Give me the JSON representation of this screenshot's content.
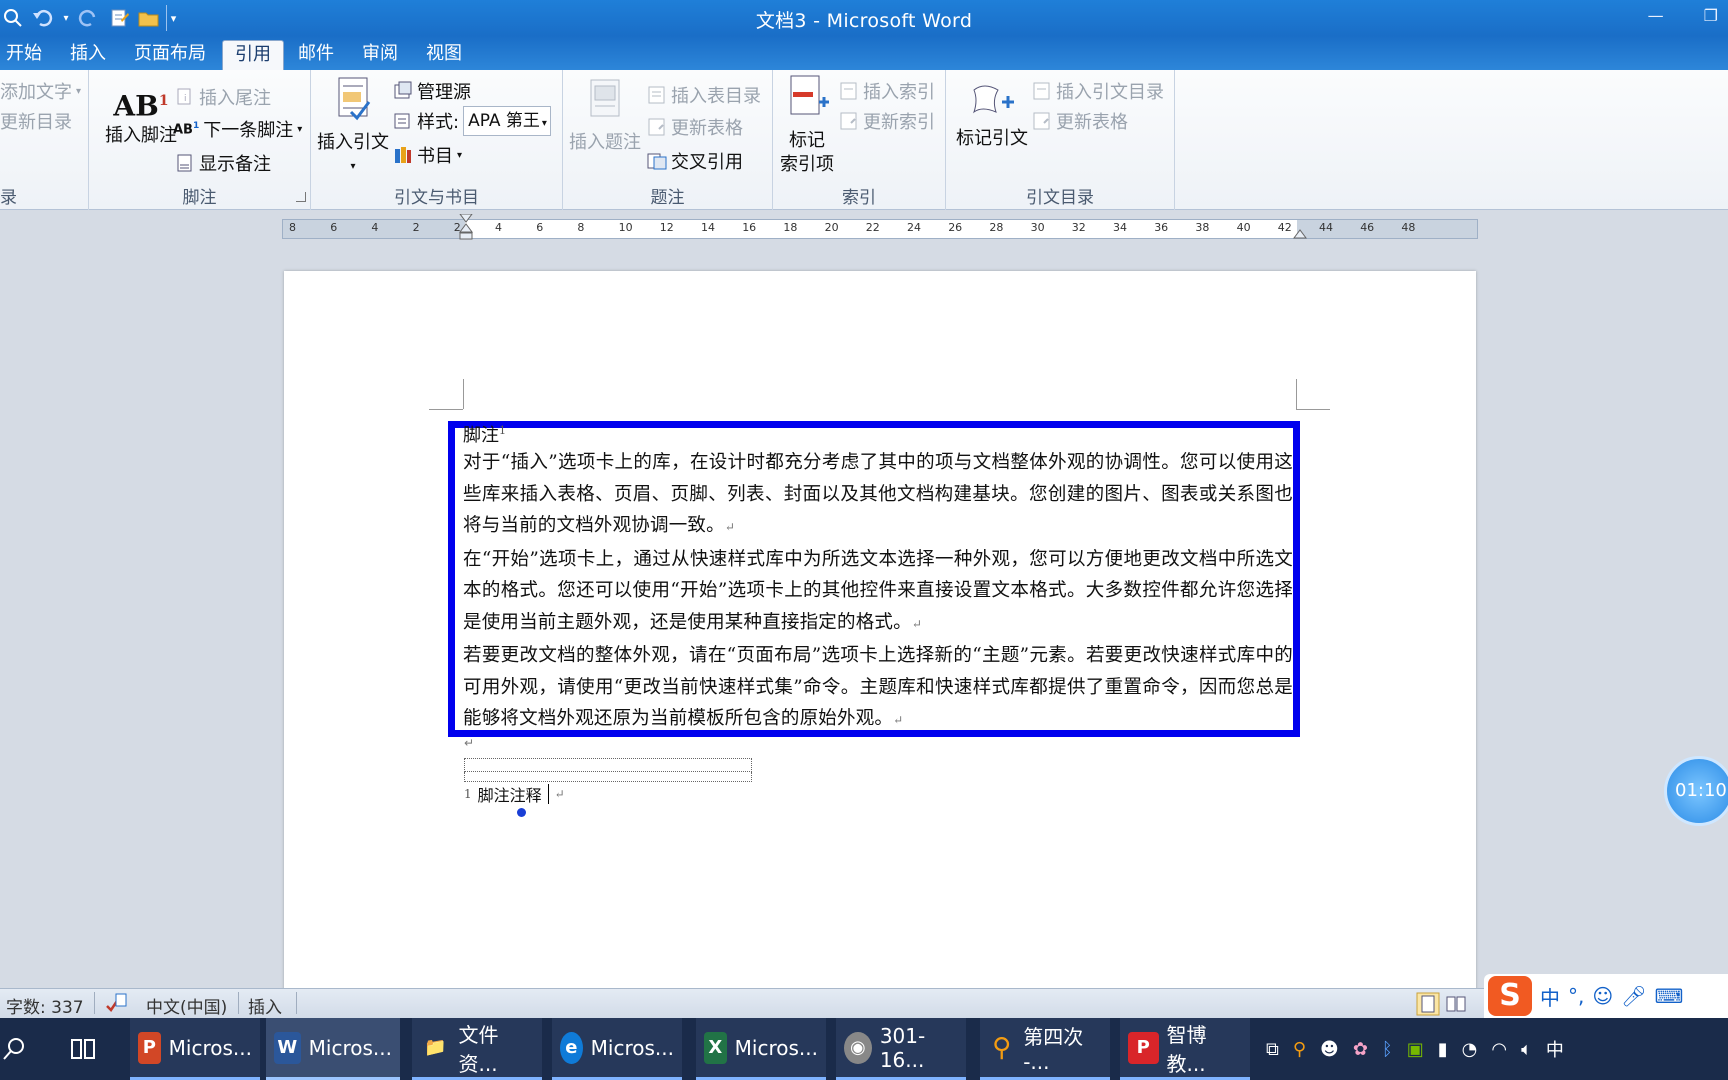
{
  "window": {
    "title": "文档3 - Microsoft Word",
    "minimize_glyph": "—",
    "restore_glyph": "❐"
  },
  "tabs": [
    "开始",
    "插入",
    "页面布局",
    "引用",
    "邮件",
    "审阅",
    "视图"
  ],
  "active_tab": "引用",
  "ribbon": {
    "toc_group": {
      "add_text": "添加文字",
      "update_toc": "更新目录",
      "label": "录"
    },
    "footnote_group": {
      "insert_footnote": "插入脚注",
      "insert_endnote": "插入尾注",
      "next_footnote": "下一条脚注",
      "show_notes": "显示备注",
      "label": "脚注"
    },
    "citation_group": {
      "insert_citation": "插入引文",
      "manage_sources": "管理源",
      "style_label": "样式:",
      "style_value": "APA 第王",
      "bibliography": "书目",
      "label": "引文与书目"
    },
    "caption_group": {
      "insert_caption": "插入题注",
      "insert_table_of_figures": "插入表目录",
      "update_table": "更新表格",
      "cross_reference": "交叉引用",
      "label": "题注"
    },
    "index_group": {
      "mark_entry_line1": "标记",
      "mark_entry_line2": "索引项",
      "insert_index": "插入索引",
      "update_index": "更新索引",
      "label": "索引"
    },
    "toa_group": {
      "mark_citation": "标记引文",
      "insert_toa": "插入引文目录",
      "update_table": "更新表格",
      "label": "引文目录"
    }
  },
  "ruler": {
    "numbers": [
      "8",
      "6",
      "4",
      "2",
      "2",
      "4",
      "6",
      "8",
      "10",
      "12",
      "14",
      "16",
      "18",
      "20",
      "22",
      "24",
      "26",
      "28",
      "30",
      "32",
      "34",
      "36",
      "38",
      "40",
      "42",
      "44",
      "46",
      "48"
    ]
  },
  "document": {
    "heading": "脚注",
    "paragraphs": [
      "对于“插入”选项卡上的库，在设计时都充分考虑了其中的项与文档整体外观的协调性。您可以使用这些库来插入表格、页眉、页脚、列表、封面以及其他文档构建基块。您创建的图片、图表或关系图也将与当前的文档外观协调一致。",
      "在“开始”选项卡上，通过从快速样式库中为所选文本选择一种外观，您可以方便地更改文档中所选文本的格式。您还可以使用“开始”选项卡上的其他控件来直接设置文本格式。大多数控件都允许您选择是使用当前主题外观，还是使用某种直接指定的格式。",
      "若要更改文档的整体外观，请在“页面布局”选项卡上选择新的“主题”元素。若要更改快速样式库中的可用外观，请使用“更改当前快速样式集”命令。主题库和快速样式库都提供了重置命令，因而您总是能够将文档外观还原为当前模板所包含的原始外观。"
    ],
    "paragraph_mark": "↵",
    "footnote_text": "脚注注释"
  },
  "timer": "01:10",
  "statusbar": {
    "word_count": "字数: 337",
    "language": "中文(中国)",
    "mode": "插入"
  },
  "ime": {
    "logo": "S",
    "lang": "中"
  },
  "taskbar": {
    "items": [
      {
        "label": "Micros...",
        "icon": "P",
        "color": "#d24726"
      },
      {
        "label": "Micros...",
        "icon": "W",
        "color": "#2b579a"
      },
      {
        "label": "文件资...",
        "icon": "📁",
        "color": "#e8a21a"
      },
      {
        "label": "Micros...",
        "icon": "e",
        "color": "#0f7bd8"
      },
      {
        "label": "Micros...",
        "icon": "X",
        "color": "#217346"
      },
      {
        "label": "301-16...",
        "icon": "◉",
        "color": "#888888"
      },
      {
        "label": "第四次 -...",
        "icon": "⚲",
        "color": "#f39c12"
      },
      {
        "label": "智博教...",
        "icon": "P",
        "color": "#d9252a"
      }
    ],
    "tray_lang": "中"
  },
  "colors": {
    "frame_border": "#0000ee",
    "title_bar": "#1f7fd8"
  }
}
